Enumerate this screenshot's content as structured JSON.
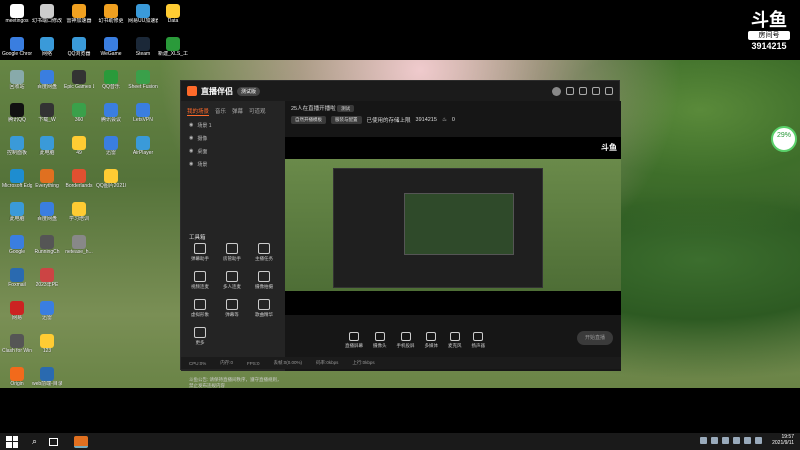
{
  "desktop": {
    "left_icons": [
      {
        "label": "meetingos",
        "color": "#ffffff"
      },
      {
        "label": "Google Chrome",
        "color": "#3a7ee0"
      },
      {
        "label": "回收站",
        "color": "#8aa"
      },
      {
        "label": "腾讯QQ",
        "color": "#111"
      },
      {
        "label": "控制面板",
        "color": "#3a9ad9"
      },
      {
        "label": "Microsoft Edge",
        "color": "#1e8dd0"
      },
      {
        "label": "此电脑",
        "color": "#3a9ad9"
      },
      {
        "label": "Google",
        "color": "#3a7ee0"
      },
      {
        "label": "Foxmail",
        "color": "#2a6ab0"
      },
      {
        "label": "网易",
        "color": "#cc2222"
      },
      {
        "label": "Clash for Windows",
        "color": "#555"
      },
      {
        "label": "Origin",
        "color": "#f26a1b"
      }
    ],
    "col2_icons": [
      {
        "label": "幻书端口修改.exe",
        "color": "#ccc"
      },
      {
        "label": "网络",
        "color": "#3a9ad9"
      },
      {
        "label": "百度网盘",
        "color": "#3a7ee0"
      },
      {
        "label": "下载_W",
        "color": "#333"
      },
      {
        "label": "此电脑",
        "color": "#3a9ad9"
      },
      {
        "label": "Everything",
        "color": "#e07020"
      },
      {
        "label": "百度网盘",
        "color": "#3a7ee0"
      },
      {
        "label": "RunningCh",
        "color": "#555"
      },
      {
        "label": "2023年PE",
        "color": "#cc4444"
      },
      {
        "label": "迅雷",
        "color": "#3a7ee0"
      },
      {
        "label": "123",
        "color": "#ffcc33"
      },
      {
        "label": "web前端-目录.docx",
        "color": "#2a6ab0"
      }
    ],
    "col3_icons": [
      {
        "label": "雷神加速器",
        "color": "#f0a020"
      },
      {
        "label": "QQ浏览器",
        "color": "#3a9ad9"
      },
      {
        "label": "Epic Games Launcher",
        "color": "#333"
      },
      {
        "label": "360",
        "color": "#3aa04a"
      },
      {
        "label": "49",
        "color": "#ffcc33"
      },
      {
        "label": "Borderlands",
        "color": "#e05030"
      },
      {
        "label": "学习培训",
        "color": "#ffcc33"
      },
      {
        "label": "netease_h...",
        "color": "#888"
      }
    ],
    "col4_icons": [
      {
        "label": "幻书助修更",
        "color": "#f0a020"
      },
      {
        "label": "WeGame",
        "color": "#3a7ee0"
      },
      {
        "label": "QQ音乐",
        "color": "#2a9a3a"
      },
      {
        "label": "腾讯会议",
        "color": "#3a7ee0"
      },
      {
        "label": "迅雷",
        "color": "#3a7ee0"
      },
      {
        "label": "QQ图片20210806...",
        "color": "#ffcc33"
      }
    ],
    "col5_icons": [
      {
        "label": "网易UU加速器",
        "color": "#3a9ad9"
      },
      {
        "label": "Steam",
        "color": "#1b2838"
      },
      {
        "label": "Sheet Fusion",
        "color": "#3aa04a"
      },
      {
        "label": "LetsVPN",
        "color": "#3a7ee0"
      },
      {
        "label": "AirPlayer",
        "color": "#3a9ad9"
      }
    ],
    "col6_icons": [
      {
        "label": "Data",
        "color": "#ffcc33"
      },
      {
        "label": "新建_XLS_工作表",
        "color": "#2a9a3a"
      }
    ],
    "douyu": {
      "logo": "斗鱼",
      "room_label": "房间号",
      "room_id": "3914215"
    },
    "perf_widget": "29%"
  },
  "app": {
    "title": "直播伴侣",
    "version": "测试版",
    "side_tabs": [
      "我的场景",
      "音乐",
      "弹幕",
      "可道观"
    ],
    "scenes": [
      "场景 1",
      "摄像",
      "桌面",
      "场景"
    ],
    "tools_title": "工具箱",
    "tools": [
      "弹幕助手",
      "房管助手",
      "主播任务",
      "视频连麦",
      "多人连麦",
      "摄像拍摄",
      "虚拟形象",
      "弹幕等",
      "歌曲精华",
      "更多"
    ],
    "stream_title": "25人在直播开播啦",
    "stream_tag": "测试",
    "info_chips": [
      "自然开播模板",
      "服装与配置"
    ],
    "info_text": "已使用的存储上限",
    "room_id": "3914215",
    "count": "0",
    "preview_logo": "斗鱼",
    "controls": [
      "直播屏幕",
      "摄像头",
      "手机投屏",
      "多媒体",
      "麦克风",
      "扬声器"
    ],
    "start_live": "开始直播",
    "notice": "斗鱼公告: 请保持直播间秩序，遵守直播规则，禁止发布违规内容",
    "status_items": [
      "CPU:0%",
      "内存:0",
      "FPS:0",
      "丢帧:0(0.00%)",
      "码率:0kbps",
      "上行:0kbps"
    ]
  },
  "taskbar": {
    "search": "⌕",
    "time": "19:57",
    "date": "2021/9/11"
  }
}
